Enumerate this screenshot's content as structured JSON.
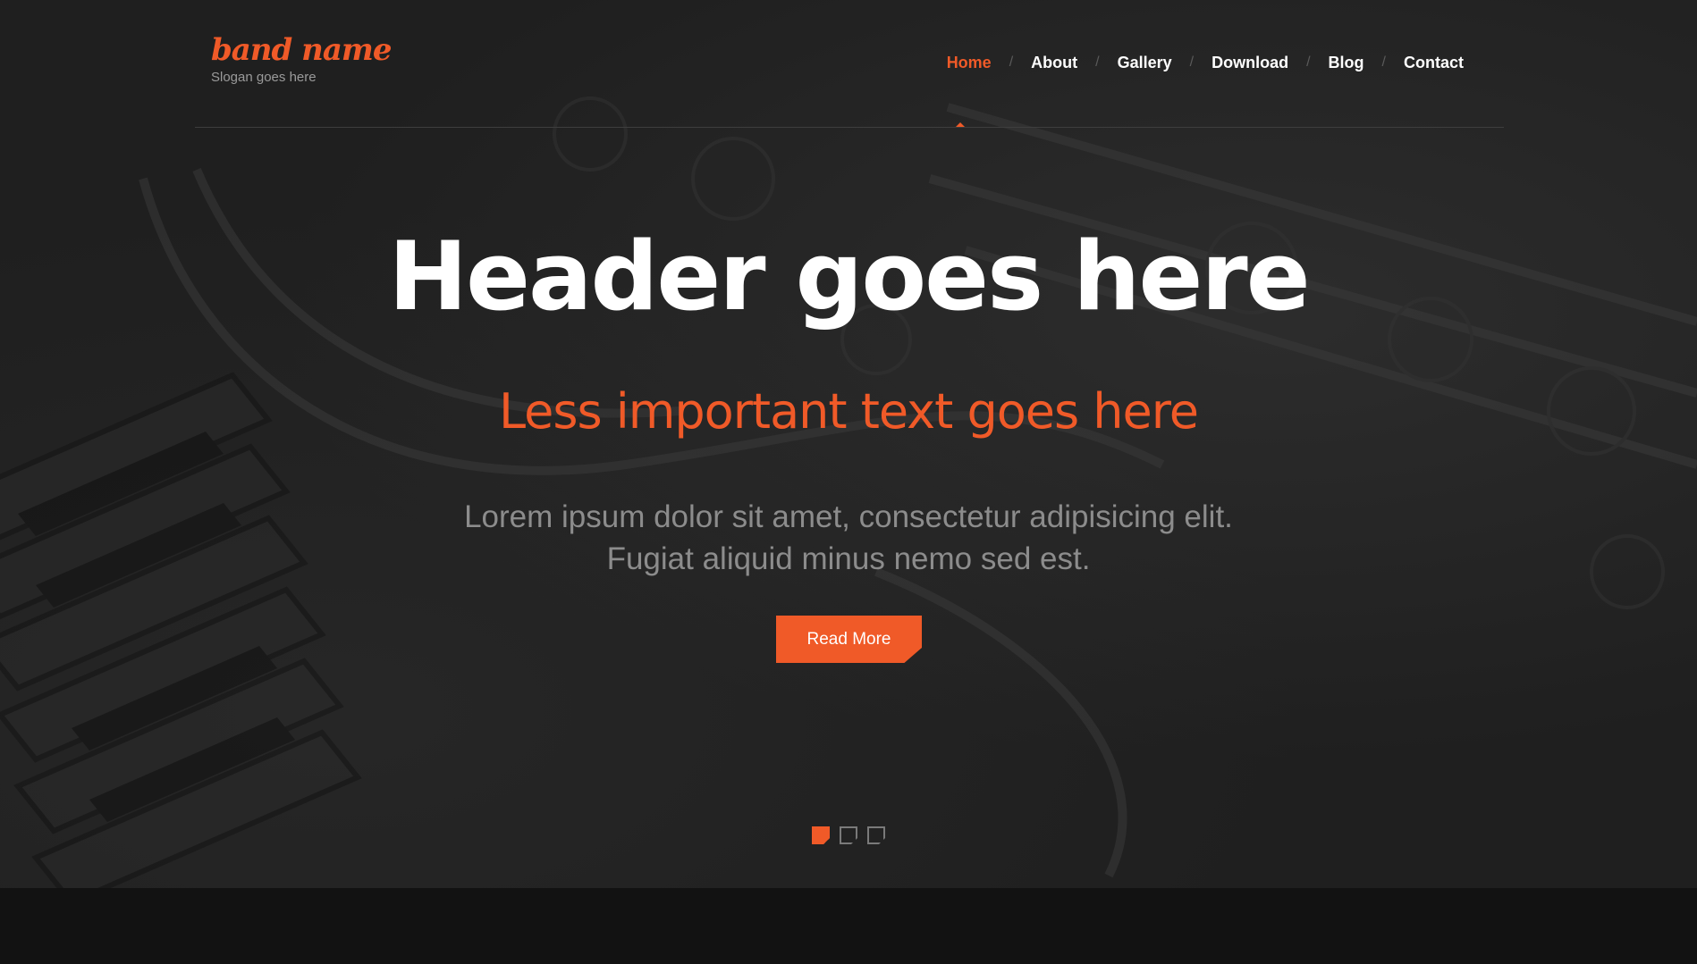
{
  "logo": {
    "name": "band name",
    "slogan": "Slogan goes here"
  },
  "nav": {
    "items": [
      {
        "label": "Home",
        "active": true
      },
      {
        "label": "About",
        "active": false
      },
      {
        "label": "Gallery",
        "active": false
      },
      {
        "label": "Download",
        "active": false
      },
      {
        "label": "Blog",
        "active": false
      },
      {
        "label": "Contact",
        "active": false
      }
    ],
    "separator": "/"
  },
  "hero": {
    "title": "Header goes here",
    "subtitle": "Less important text goes here",
    "body_line1": "Lorem ipsum dolor sit amet, consectetur adipisicing elit.",
    "body_line2": "Fugiat aliquid minus nemo sed est.",
    "button_label": "Read More"
  },
  "slider": {
    "slide_count": 3,
    "active_index": 0
  },
  "colors": {
    "accent": "#f05a28",
    "background": "#1f1f1f",
    "footer_band": "#121212",
    "muted_text": "#8c8c8c"
  }
}
